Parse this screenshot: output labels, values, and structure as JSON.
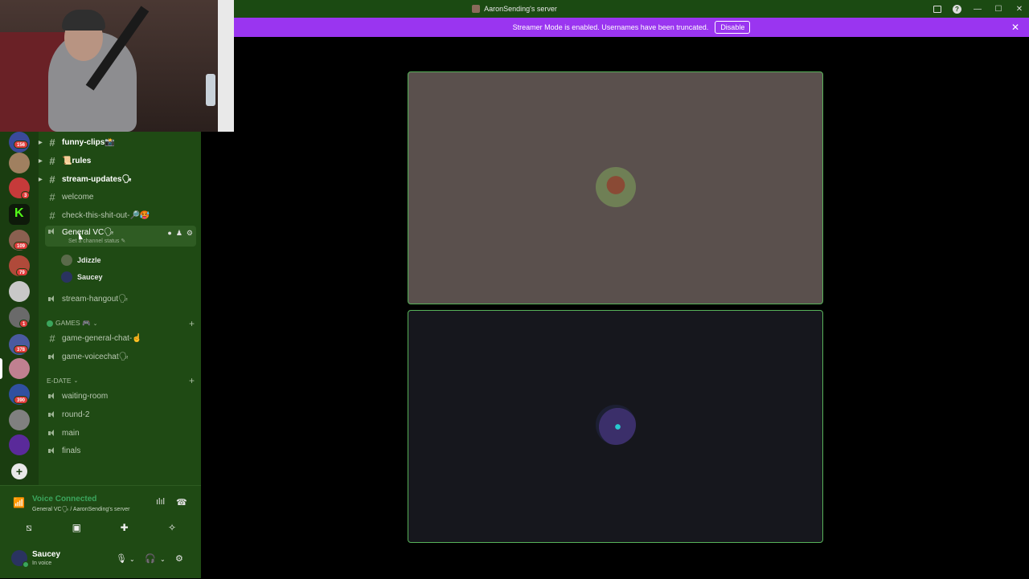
{
  "window": {
    "title": "AaronSending's server"
  },
  "banner": {
    "text": "Streamer Mode is enabled. Usernames have been truncated.",
    "button": "Disable"
  },
  "servers": {
    "badges": [
      "156",
      "3",
      "109",
      "79",
      "1",
      "378",
      "390"
    ],
    "colors": [
      "#3a4a9a",
      "#a08060",
      "#c63a3a",
      "#53fc18",
      "#8a6050",
      "#b04a3a",
      "#c8c8c8",
      "#6a6a6a",
      "#4a5aa0",
      "#c08090",
      "#3050a0",
      "#808080",
      "#5a2a9a"
    ]
  },
  "channels": {
    "text": [
      {
        "label": "funny-clips📸",
        "bold": true
      },
      {
        "label": "📜rules",
        "bold": true
      },
      {
        "label": "stream-updates🗣",
        "bold": true
      },
      {
        "label": "welcome",
        "bold": false
      },
      {
        "label": "check-this-shit-out-🔎🥵",
        "bold": false
      }
    ],
    "active_voice": {
      "label": "General VC🗣",
      "status": "Set a channel status ✎"
    },
    "members": [
      "Jdizzle",
      "Saucey"
    ],
    "stream_hangout": "stream-hangout🗣",
    "games_category": "GAMES 🎮",
    "games_channels": [
      "game-general-chat-☝",
      "game-voicechat🗣"
    ],
    "edate_category": "E-DATE",
    "edate_channels": [
      "waiting-room",
      "round-2",
      "main",
      "finals"
    ]
  },
  "voice": {
    "title": "Voice Connected",
    "subtitle": "General VC🗣 / AaronSending's server"
  },
  "user": {
    "name": "Saucey",
    "status": "In voice"
  },
  "colors": {
    "accent": "#3ba55d",
    "banner": "#9a35f0",
    "sidebar": "#1f4a14",
    "tile_border": "#58b35a"
  }
}
